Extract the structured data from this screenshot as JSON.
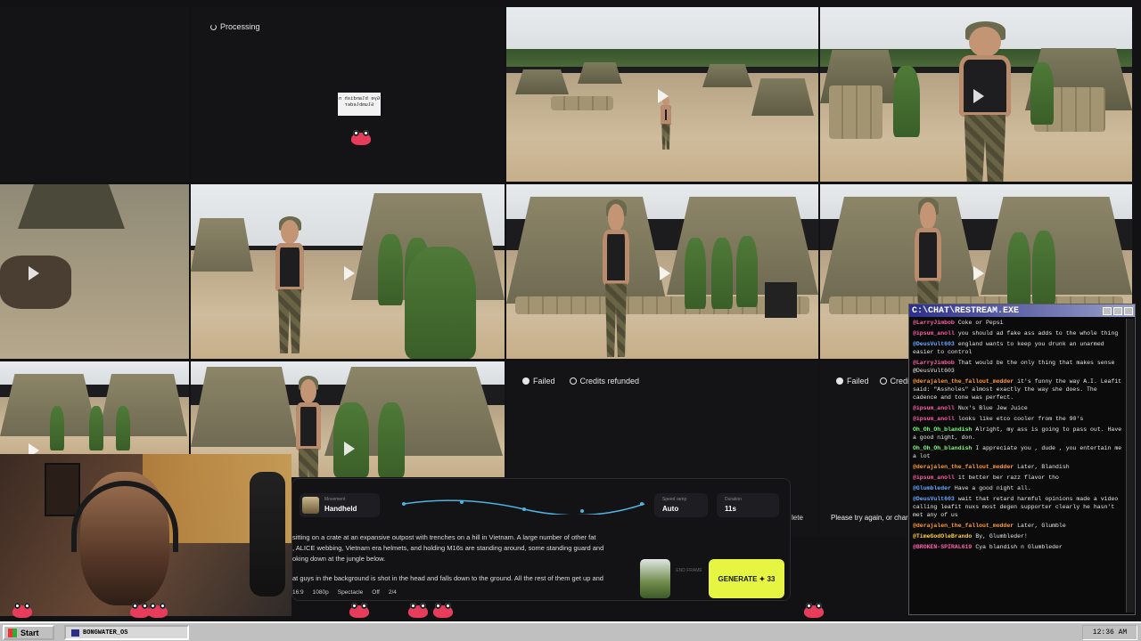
{
  "tiles": {
    "processing_label": "Processing",
    "failed_label": "Failed",
    "credits_refunded_label": "Credits refunded",
    "credits_truncated_label": "Credi",
    "retry_hint": "Please try again, or char",
    "delete_fragment": "lete"
  },
  "panel": {
    "movement_label": "Movement",
    "movement_value": "Handheld",
    "speed_label": "Speed ramp",
    "speed_value": "Auto",
    "duration_label": "Duration",
    "duration_value": "11s",
    "prompt_line1": "sitting on a crate at an expansive outpost with trenches on a hill in Vietnam. A large number of other fat",
    "prompt_line2": ", ALICE webbing, Vietnam era helmets, and holding M16s are standing around, some standing guard and",
    "prompt_line3": "oking down at the jungle below.",
    "prompt_line4": "at guys in the background is shot in the head and falls down to the ground. All the rest of them get up and",
    "end_frame_label": "END FRAME",
    "generate_label": "GENERATE ✦ 33",
    "aspect": "16:9",
    "resolution": "1080p",
    "style": "Spectacle",
    "toggle": "Off",
    "count": "2/4"
  },
  "chat": {
    "title": "C:\\CHAT\\RESTREAM.EXE",
    "messages": [
      {
        "user": "@LarryJimbob",
        "text": "Coke or Pepsi",
        "color": "#ff5fa8"
      },
      {
        "user": "@ipsum_anoll",
        "text": "you should ad fake ass adds to the whole thing",
        "color": "#ff5fa8"
      },
      {
        "user": "@DeusVult603",
        "text": "england wants to keep you drunk an unarmed easier to control",
        "color": "#6aa6ff"
      },
      {
        "user": "@LarryJimbob",
        "text": "That would be the only thing that makes sense @DeusVult603",
        "color": "#ff5fa8"
      },
      {
        "user": "@derajalen_the_fallout_modder",
        "text": "it's funny the way A.I. Leafit said: \"Assholes\" almost exactly the way she does. The cadence and tone was perfect.",
        "color": "#ff9a3c"
      },
      {
        "user": "@ipsum_anoll",
        "text": "Nux's Blue Jew Juice",
        "color": "#ff5fa8"
      },
      {
        "user": "@ipsum_anoll",
        "text": "looks like etco cooler from the 90's",
        "color": "#ff5fa8"
      },
      {
        "user": "Oh_Oh_Oh_blandish",
        "text": "Alright, my ass is going to pass out. Have a good night, don.",
        "color": "#7dff7d"
      },
      {
        "user": "Oh_Oh_Oh_blandish",
        "text": "I appreciate you , dude , you entertain me a lot",
        "color": "#7dff7d"
      },
      {
        "user": "@derajalen_the_fallout_modder",
        "text": "Later, Blandish",
        "color": "#ff9a3c"
      },
      {
        "user": "@ipsum_anoll",
        "text": "it better ber razz flavor tho",
        "color": "#ff5fa8"
      },
      {
        "user": "@Glumbleder",
        "text": "Have a good night all.",
        "color": "#6aa6ff"
      },
      {
        "user": "@DeusVult603",
        "text": "wait that retard harmful opinions made a video calling leafit nuxs most degen supporter clearly he hasn't met any of us",
        "color": "#6aa6ff"
      },
      {
        "user": "@derajalen_the_fallout_modder",
        "text": "Later, Glumble",
        "color": "#ff9a3c"
      },
      {
        "user": "@TimeGodOleBrando",
        "text": "By, Glumbleder!",
        "color": "#ffd23c"
      },
      {
        "user": "@BROKEN-SPIRAL619",
        "text": "Cya blandish n Glumbleder",
        "color": "#ff5fa8"
      }
    ]
  },
  "taskbar": {
    "start_label": "Start",
    "window_label": "BONGWATER_OS",
    "clock": "12:36 AM"
  },
  "overlay": {
    "mirrored_sign": "Gye blandish n Glumbleder"
  },
  "colors": {
    "generate_button": "#e6f542",
    "chat_titlebar": "#2c2f8a",
    "taskbar": "#c0c0c0"
  }
}
